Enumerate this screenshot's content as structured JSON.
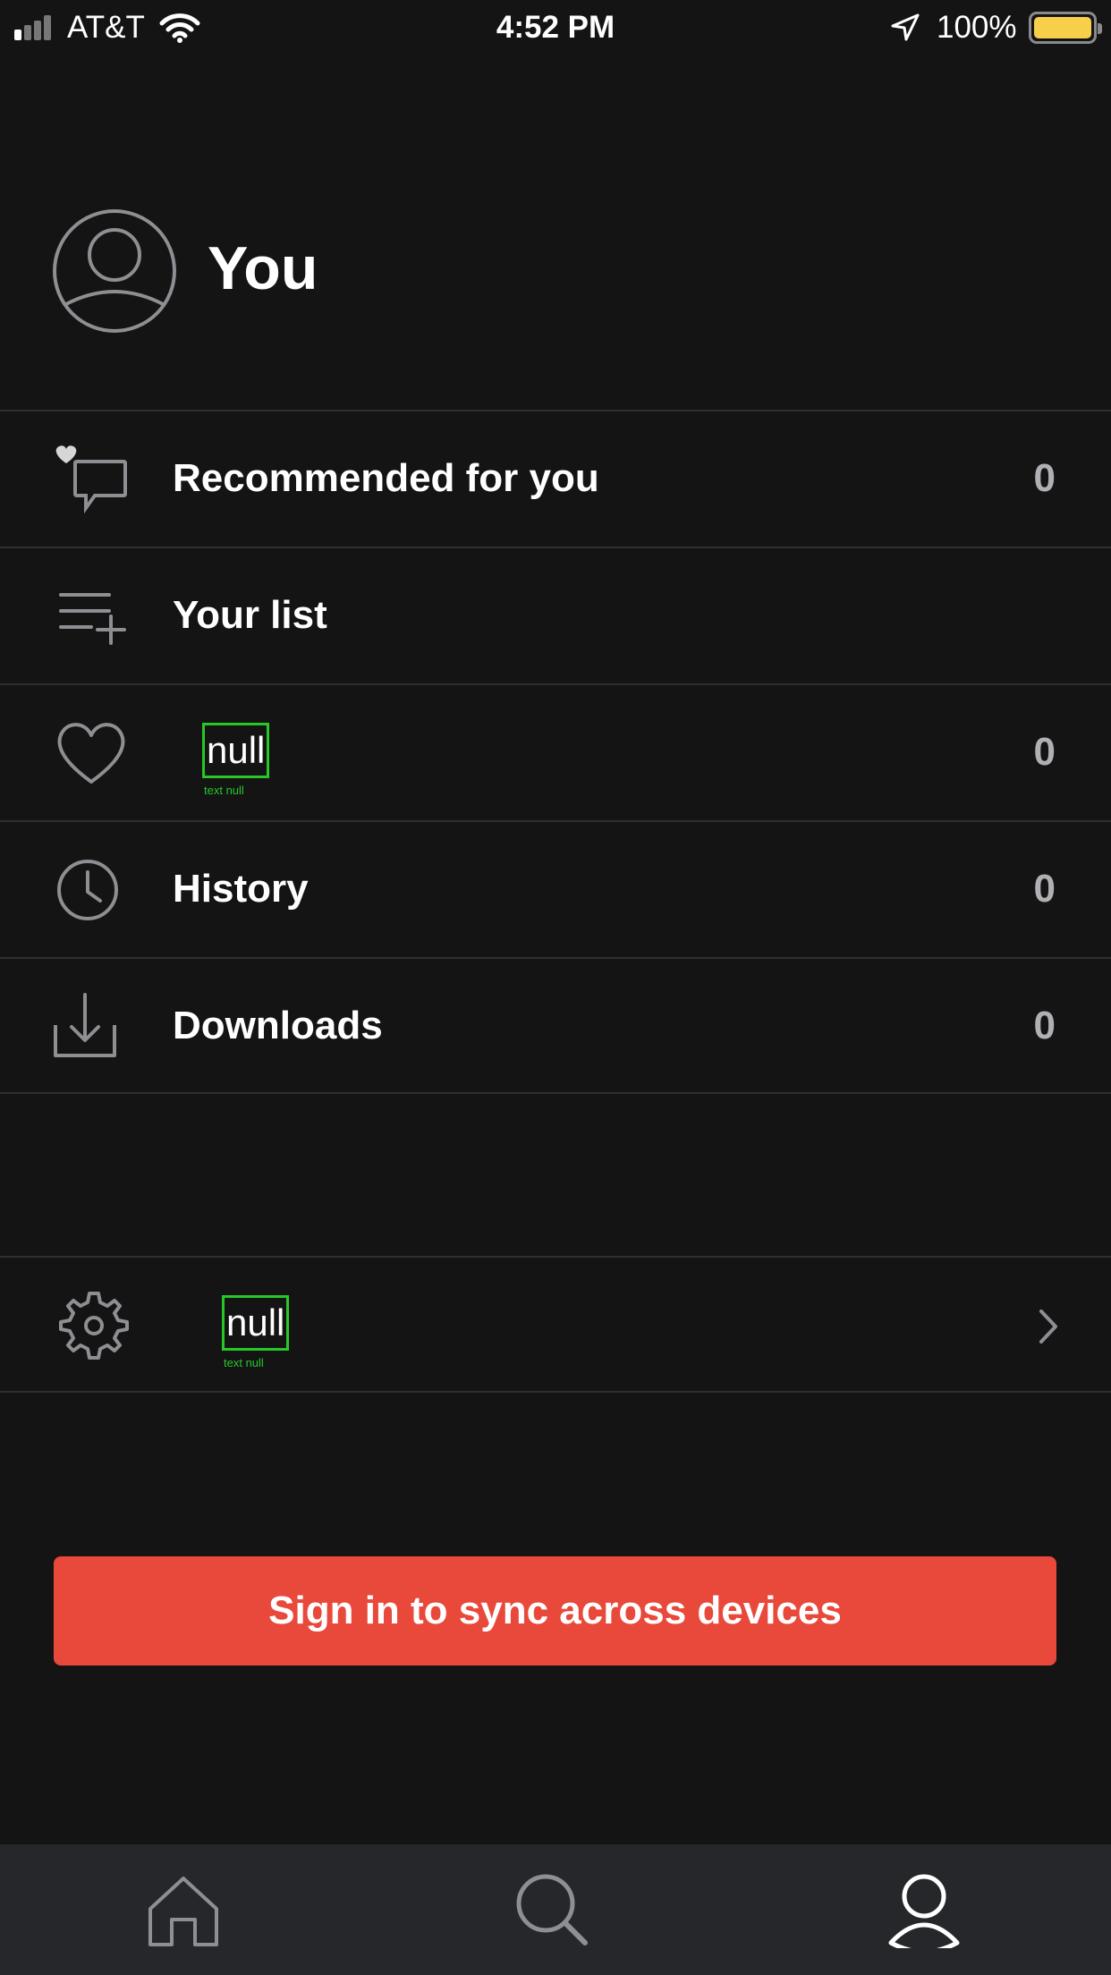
{
  "status_bar": {
    "carrier": "AT&T",
    "time": "4:52 PM",
    "battery": "100%"
  },
  "profile": {
    "title": "You"
  },
  "menu": [
    {
      "label": "Recommended for you",
      "count": "0",
      "icon": "heart-chat-icon"
    },
    {
      "label": "Your list",
      "count": "",
      "icon": "list-add-icon"
    },
    {
      "label": "null",
      "caption": "text null",
      "count": "0",
      "icon": "heart-icon"
    },
    {
      "label": "History",
      "count": "0",
      "icon": "clock-icon"
    },
    {
      "label": "Downloads",
      "count": "0",
      "icon": "download-icon"
    }
  ],
  "settings": {
    "label": "null",
    "caption": "text null",
    "icon": "gear-icon"
  },
  "cta": {
    "label": "Sign in to sync across devices",
    "color": "#e8493a"
  },
  "tabbar": {
    "tabs": [
      {
        "name": "home",
        "icon": "home-icon",
        "active": false
      },
      {
        "name": "search",
        "icon": "search-icon",
        "active": false
      },
      {
        "name": "profile",
        "icon": "profile-icon",
        "active": true
      }
    ]
  },
  "colors": {
    "background": "#141415",
    "divider": "#2f2f31",
    "icon_gray": "#8e8e93",
    "tabbar": "#26272b"
  }
}
